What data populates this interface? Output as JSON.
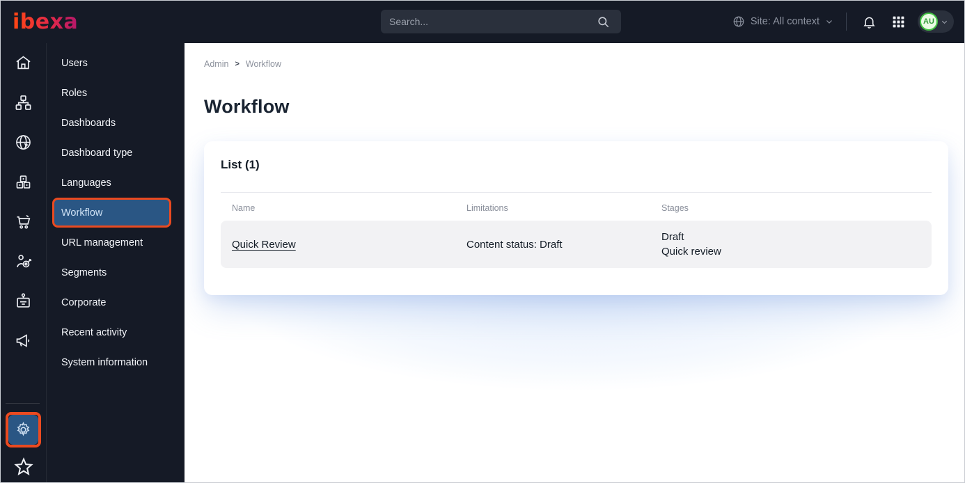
{
  "brand": {
    "logo_text": "ibexa"
  },
  "topbar": {
    "search": {
      "placeholder": "Search..."
    },
    "site_context": {
      "label": "Site: All context"
    },
    "user": {
      "initials": "AU"
    }
  },
  "sidebar": {
    "rail_icons": [
      {
        "name": "home"
      },
      {
        "name": "content-tree"
      },
      {
        "name": "site-globe"
      },
      {
        "name": "product-blocks"
      },
      {
        "name": "commerce-cart"
      },
      {
        "name": "personalization-target"
      },
      {
        "name": "corporate-badge"
      },
      {
        "name": "marketing-megaphone"
      }
    ],
    "bottom_icons": [
      {
        "name": "settings-gear",
        "active": true
      },
      {
        "name": "favorites-star"
      }
    ]
  },
  "menu": {
    "items": [
      "Users",
      "Roles",
      "Dashboards",
      "Dashboard type",
      "Languages",
      "Workflow",
      "URL management",
      "Segments",
      "Corporate",
      "Recent activity",
      "System information"
    ],
    "active_item": "Workflow"
  },
  "breadcrumb": {
    "items": [
      "Admin",
      "Workflow"
    ],
    "separator": ">"
  },
  "page": {
    "title": "Workflow"
  },
  "card": {
    "title": "List (1)",
    "table": {
      "columns": [
        "Name",
        "Limitations",
        "Stages"
      ],
      "rows": [
        {
          "name": "Quick Review",
          "limitations": "Content status: Draft",
          "stages": [
            "Draft",
            "Quick review"
          ]
        }
      ]
    }
  },
  "colors": {
    "topbar_bg": "#151a26",
    "highlight_border": "#ea4a20",
    "active_blue": "#2a5684",
    "avatar_green": "#43c343",
    "brand_gradient_start": "#ff4713",
    "brand_gradient_end": "#b5176b"
  }
}
